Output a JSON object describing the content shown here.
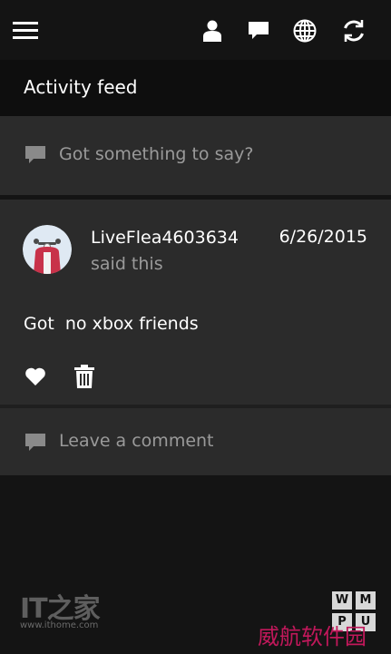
{
  "topbar": {
    "icons": [
      "hamburger-menu-icon",
      "person-icon",
      "message-icon",
      "globe-icon",
      "refresh-icon"
    ]
  },
  "header": {
    "title": "Activity feed"
  },
  "composer": {
    "placeholder": "Got something to say?",
    "icon": "comment-icon"
  },
  "post": {
    "username": "LiveFlea4603634",
    "subtext": "said this",
    "date": "6/26/2015",
    "body": "Got  no xbox friends",
    "actions": [
      "heart-icon",
      "trash-icon"
    ]
  },
  "comment": {
    "placeholder": "Leave a comment",
    "icon": "comment-icon"
  },
  "watermarks": {
    "it_logo": "IT之家",
    "it_url": "www.ithome.com",
    "grid_letters": [
      "W",
      "M",
      "P",
      "U"
    ],
    "cn_text": "威航软件园"
  },
  "colors": {
    "background": "#141414",
    "panel": "#2b2b2b",
    "header": "#0e0e0e",
    "muted_text": "#9a9a9a",
    "watermark_pink": "#c2185b"
  }
}
